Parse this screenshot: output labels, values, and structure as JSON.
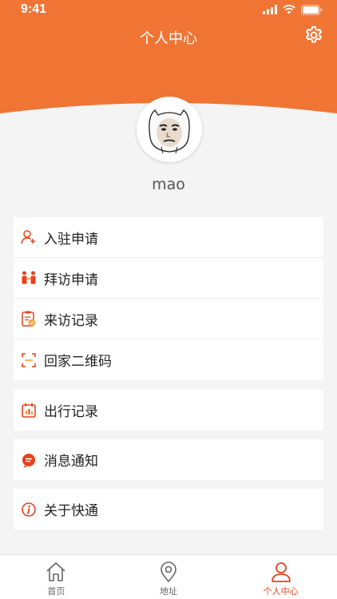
{
  "status_bar": {
    "time": "9:41"
  },
  "header": {
    "title": "个人中心"
  },
  "profile": {
    "username": "mao"
  },
  "menu_groups": [
    [
      {
        "label": "入驻申请",
        "icon": "user-add-icon"
      },
      {
        "label": "拜访申请",
        "icon": "visit-icon"
      },
      {
        "label": "来访记录",
        "icon": "record-icon"
      },
      {
        "label": "回家二维码",
        "icon": "qr-code-icon"
      }
    ],
    [
      {
        "label": "出行记录",
        "icon": "travel-record-icon"
      }
    ],
    [
      {
        "label": "消息通知",
        "icon": "message-icon"
      }
    ],
    [
      {
        "label": "关于快通",
        "icon": "info-icon"
      }
    ]
  ],
  "tabbar": {
    "items": [
      {
        "label": "首页",
        "icon": "home-icon",
        "active": false
      },
      {
        "label": "地址",
        "icon": "location-pin-icon",
        "active": false
      },
      {
        "label": "个人中心",
        "icon": "person-icon",
        "active": true
      }
    ]
  },
  "colors": {
    "accent": "#f07535",
    "icon_red": "#e8411c",
    "background": "#f4f4f4"
  }
}
